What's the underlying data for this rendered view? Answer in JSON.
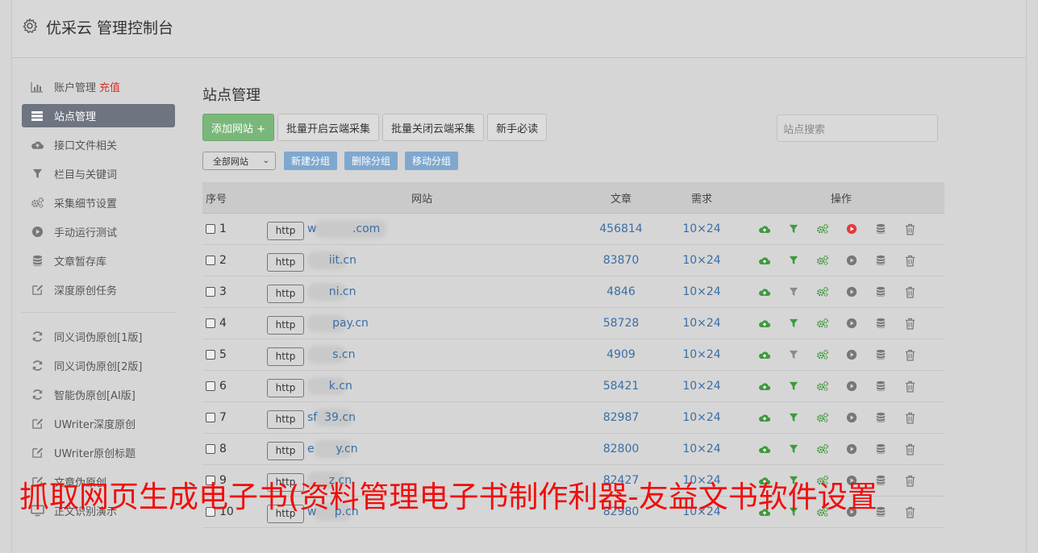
{
  "app": {
    "title": "优采云 管理控制台",
    "icon": "gear-icon"
  },
  "sidebar": {
    "items": [
      {
        "label": "账户管理",
        "extra": "充值",
        "icon": "bar-chart-icon"
      },
      {
        "label": "站点管理",
        "icon": "server-list-icon",
        "active": true
      },
      {
        "label": "接口文件相关",
        "icon": "cloud-upload-icon"
      },
      {
        "label": "栏目与关键词",
        "icon": "filter-icon"
      },
      {
        "label": "采集细节设置",
        "icon": "cogs-icon"
      },
      {
        "label": "手动运行测试",
        "icon": "play-circle-icon"
      },
      {
        "label": "文章暂存库",
        "icon": "database-icon"
      },
      {
        "label": "深度原创任务",
        "icon": "edit-icon"
      }
    ],
    "items2": [
      {
        "label": "同义词伪原创[1版]",
        "icon": "refresh-icon"
      },
      {
        "label": "同义词伪原创[2版]",
        "icon": "refresh-icon"
      },
      {
        "label": "智能伪原创[AI版]",
        "icon": "refresh-icon"
      },
      {
        "label": "UWriter深度原创",
        "icon": "edit-icon"
      },
      {
        "label": "UWriter原创标题",
        "icon": "edit-icon"
      },
      {
        "label": "文章伪原创",
        "icon": "edit-icon"
      },
      {
        "label": "正文识别演示",
        "icon": "monitor-icon"
      }
    ]
  },
  "main": {
    "title": "站点管理",
    "buttons": {
      "add_site": "添加网站 +",
      "batch_on": "批量开启云端采集",
      "batch_off": "批量关闭云端采集",
      "newbie": "新手必读"
    },
    "search_placeholder": "站点搜索",
    "group_select": "全部网站",
    "group_buttons": {
      "new": "新建分组",
      "delete": "删除分组",
      "move": "移动分组"
    },
    "table": {
      "headers": {
        "no": "序号",
        "site": "网站",
        "articles": "文章",
        "demand": "需求",
        "ops": "操作"
      },
      "rows": [
        {
          "no": "1",
          "proto": "http",
          "domain": "w          .com",
          "articles": "456814",
          "demand": "10×24",
          "filter_on": true,
          "run_active": true
        },
        {
          "no": "2",
          "proto": "http",
          "domain": "      iit.cn",
          "articles": "83870",
          "demand": "10×24",
          "filter_on": true,
          "run_active": false
        },
        {
          "no": "3",
          "proto": "http",
          "domain": "      ni.cn",
          "articles": "4846",
          "demand": "10×24",
          "filter_on": false,
          "run_active": false
        },
        {
          "no": "4",
          "proto": "http",
          "domain": "       pay.cn",
          "articles": "58728",
          "demand": "10×24",
          "filter_on": true,
          "run_active": false
        },
        {
          "no": "5",
          "proto": "http",
          "domain": "       s.cn",
          "articles": "4909",
          "demand": "10×24",
          "filter_on": false,
          "run_active": false
        },
        {
          "no": "6",
          "proto": "http",
          "domain": "      k.cn",
          "articles": "58421",
          "demand": "10×24",
          "filter_on": true,
          "run_active": false
        },
        {
          "no": "7",
          "proto": "http",
          "domain": "sf  39.cn",
          "articles": "82987",
          "demand": "10×24",
          "filter_on": true,
          "run_active": false
        },
        {
          "no": "8",
          "proto": "http",
          "domain": "e      y.cn",
          "articles": "82800",
          "demand": "10×24",
          "filter_on": true,
          "run_active": false
        },
        {
          "no": "9",
          "proto": "http",
          "domain": "      z.cn",
          "articles": "82427",
          "demand": "10×24",
          "filter_on": true,
          "run_active": false
        },
        {
          "no": "10",
          "proto": "http",
          "domain": "w     p.cn",
          "articles": "82980",
          "demand": "10×24",
          "filter_on": true,
          "run_active": false
        }
      ]
    }
  },
  "overlay_text": "抓取网页生成电子书(资料管理电子书制作利器-友益文书软件设置",
  "colors": {
    "accent_green": "#3c9a3c",
    "run_red": "#e23b3b",
    "link_blue": "#3a6ea5",
    "overlay_red": "#f20c0c"
  }
}
